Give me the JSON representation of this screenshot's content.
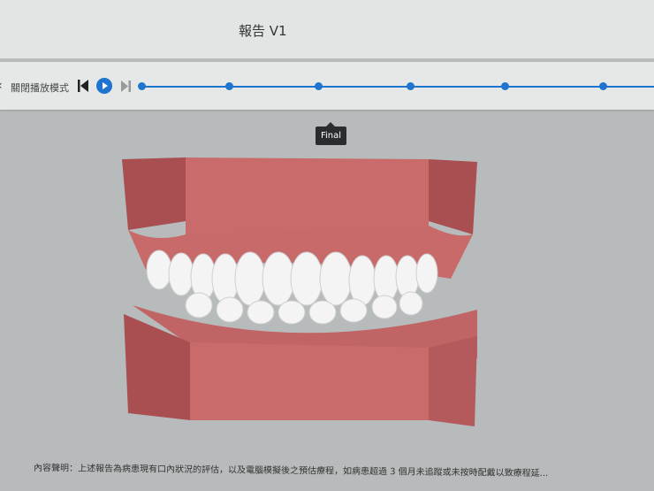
{
  "header": {
    "title": "報告 V1"
  },
  "toolbar": {
    "close_label": "關閉播放模式",
    "stages": 6
  },
  "tooltip": {
    "label": "Final"
  },
  "footer": {
    "disclaimer": "內容聲明：上述報告為病患現有口內狀況的評估，以及電腦模擬後之預估療程，如病患超過 3 個月未追蹤或未按時配戴以致療程延..."
  },
  "colors": {
    "accent": "#1f74cf",
    "gum": "#c96b6b",
    "tooth": "#f4f4f4"
  }
}
